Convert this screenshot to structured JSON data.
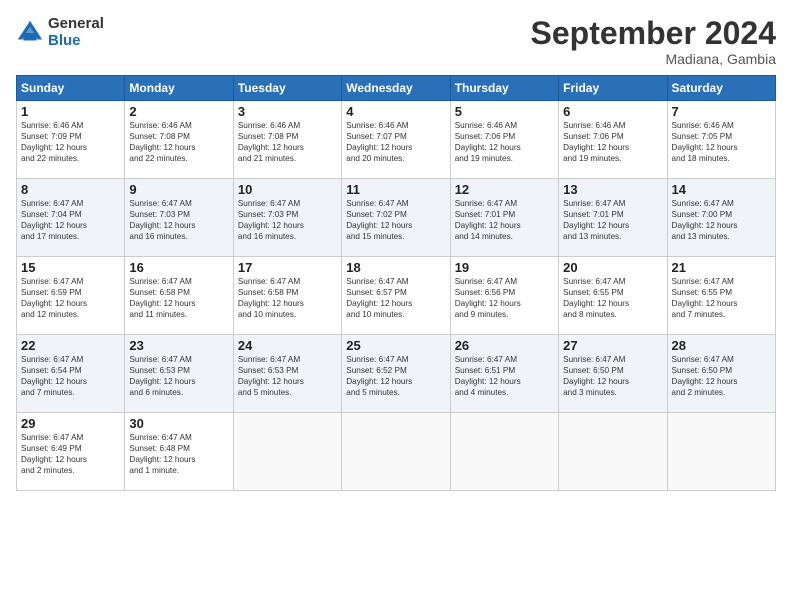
{
  "header": {
    "logo_general": "General",
    "logo_blue": "Blue",
    "month_title": "September 2024",
    "location": "Madiana, Gambia"
  },
  "days_of_week": [
    "Sunday",
    "Monday",
    "Tuesday",
    "Wednesday",
    "Thursday",
    "Friday",
    "Saturday"
  ],
  "weeks": [
    [
      {
        "day": 1,
        "lines": [
          "Sunrise: 6:46 AM",
          "Sunset: 7:09 PM",
          "Daylight: 12 hours",
          "and 22 minutes."
        ]
      },
      {
        "day": 2,
        "lines": [
          "Sunrise: 6:46 AM",
          "Sunset: 7:08 PM",
          "Daylight: 12 hours",
          "and 22 minutes."
        ]
      },
      {
        "day": 3,
        "lines": [
          "Sunrise: 6:46 AM",
          "Sunset: 7:08 PM",
          "Daylight: 12 hours",
          "and 21 minutes."
        ]
      },
      {
        "day": 4,
        "lines": [
          "Sunrise: 6:46 AM",
          "Sunset: 7:07 PM",
          "Daylight: 12 hours",
          "and 20 minutes."
        ]
      },
      {
        "day": 5,
        "lines": [
          "Sunrise: 6:46 AM",
          "Sunset: 7:06 PM",
          "Daylight: 12 hours",
          "and 19 minutes."
        ]
      },
      {
        "day": 6,
        "lines": [
          "Sunrise: 6:46 AM",
          "Sunset: 7:06 PM",
          "Daylight: 12 hours",
          "and 19 minutes."
        ]
      },
      {
        "day": 7,
        "lines": [
          "Sunrise: 6:46 AM",
          "Sunset: 7:05 PM",
          "Daylight: 12 hours",
          "and 18 minutes."
        ]
      }
    ],
    [
      {
        "day": 8,
        "lines": [
          "Sunrise: 6:47 AM",
          "Sunset: 7:04 PM",
          "Daylight: 12 hours",
          "and 17 minutes."
        ]
      },
      {
        "day": 9,
        "lines": [
          "Sunrise: 6:47 AM",
          "Sunset: 7:03 PM",
          "Daylight: 12 hours",
          "and 16 minutes."
        ]
      },
      {
        "day": 10,
        "lines": [
          "Sunrise: 6:47 AM",
          "Sunset: 7:03 PM",
          "Daylight: 12 hours",
          "and 16 minutes."
        ]
      },
      {
        "day": 11,
        "lines": [
          "Sunrise: 6:47 AM",
          "Sunset: 7:02 PM",
          "Daylight: 12 hours",
          "and 15 minutes."
        ]
      },
      {
        "day": 12,
        "lines": [
          "Sunrise: 6:47 AM",
          "Sunset: 7:01 PM",
          "Daylight: 12 hours",
          "and 14 minutes."
        ]
      },
      {
        "day": 13,
        "lines": [
          "Sunrise: 6:47 AM",
          "Sunset: 7:01 PM",
          "Daylight: 12 hours",
          "and 13 minutes."
        ]
      },
      {
        "day": 14,
        "lines": [
          "Sunrise: 6:47 AM",
          "Sunset: 7:00 PM",
          "Daylight: 12 hours",
          "and 13 minutes."
        ]
      }
    ],
    [
      {
        "day": 15,
        "lines": [
          "Sunrise: 6:47 AM",
          "Sunset: 6:59 PM",
          "Daylight: 12 hours",
          "and 12 minutes."
        ]
      },
      {
        "day": 16,
        "lines": [
          "Sunrise: 6:47 AM",
          "Sunset: 6:58 PM",
          "Daylight: 12 hours",
          "and 11 minutes."
        ]
      },
      {
        "day": 17,
        "lines": [
          "Sunrise: 6:47 AM",
          "Sunset: 6:58 PM",
          "Daylight: 12 hours",
          "and 10 minutes."
        ]
      },
      {
        "day": 18,
        "lines": [
          "Sunrise: 6:47 AM",
          "Sunset: 6:57 PM",
          "Daylight: 12 hours",
          "and 10 minutes."
        ]
      },
      {
        "day": 19,
        "lines": [
          "Sunrise: 6:47 AM",
          "Sunset: 6:56 PM",
          "Daylight: 12 hours",
          "and 9 minutes."
        ]
      },
      {
        "day": 20,
        "lines": [
          "Sunrise: 6:47 AM",
          "Sunset: 6:55 PM",
          "Daylight: 12 hours",
          "and 8 minutes."
        ]
      },
      {
        "day": 21,
        "lines": [
          "Sunrise: 6:47 AM",
          "Sunset: 6:55 PM",
          "Daylight: 12 hours",
          "and 7 minutes."
        ]
      }
    ],
    [
      {
        "day": 22,
        "lines": [
          "Sunrise: 6:47 AM",
          "Sunset: 6:54 PM",
          "Daylight: 12 hours",
          "and 7 minutes."
        ]
      },
      {
        "day": 23,
        "lines": [
          "Sunrise: 6:47 AM",
          "Sunset: 6:53 PM",
          "Daylight: 12 hours",
          "and 6 minutes."
        ]
      },
      {
        "day": 24,
        "lines": [
          "Sunrise: 6:47 AM",
          "Sunset: 6:53 PM",
          "Daylight: 12 hours",
          "and 5 minutes."
        ]
      },
      {
        "day": 25,
        "lines": [
          "Sunrise: 6:47 AM",
          "Sunset: 6:52 PM",
          "Daylight: 12 hours",
          "and 5 minutes."
        ]
      },
      {
        "day": 26,
        "lines": [
          "Sunrise: 6:47 AM",
          "Sunset: 6:51 PM",
          "Daylight: 12 hours",
          "and 4 minutes."
        ]
      },
      {
        "day": 27,
        "lines": [
          "Sunrise: 6:47 AM",
          "Sunset: 6:50 PM",
          "Daylight: 12 hours",
          "and 3 minutes."
        ]
      },
      {
        "day": 28,
        "lines": [
          "Sunrise: 6:47 AM",
          "Sunset: 6:50 PM",
          "Daylight: 12 hours",
          "and 2 minutes."
        ]
      }
    ],
    [
      {
        "day": 29,
        "lines": [
          "Sunrise: 6:47 AM",
          "Sunset: 6:49 PM",
          "Daylight: 12 hours",
          "and 2 minutes."
        ]
      },
      {
        "day": 30,
        "lines": [
          "Sunrise: 6:47 AM",
          "Sunset: 6:48 PM",
          "Daylight: 12 hours",
          "and 1 minute."
        ]
      },
      null,
      null,
      null,
      null,
      null
    ]
  ]
}
